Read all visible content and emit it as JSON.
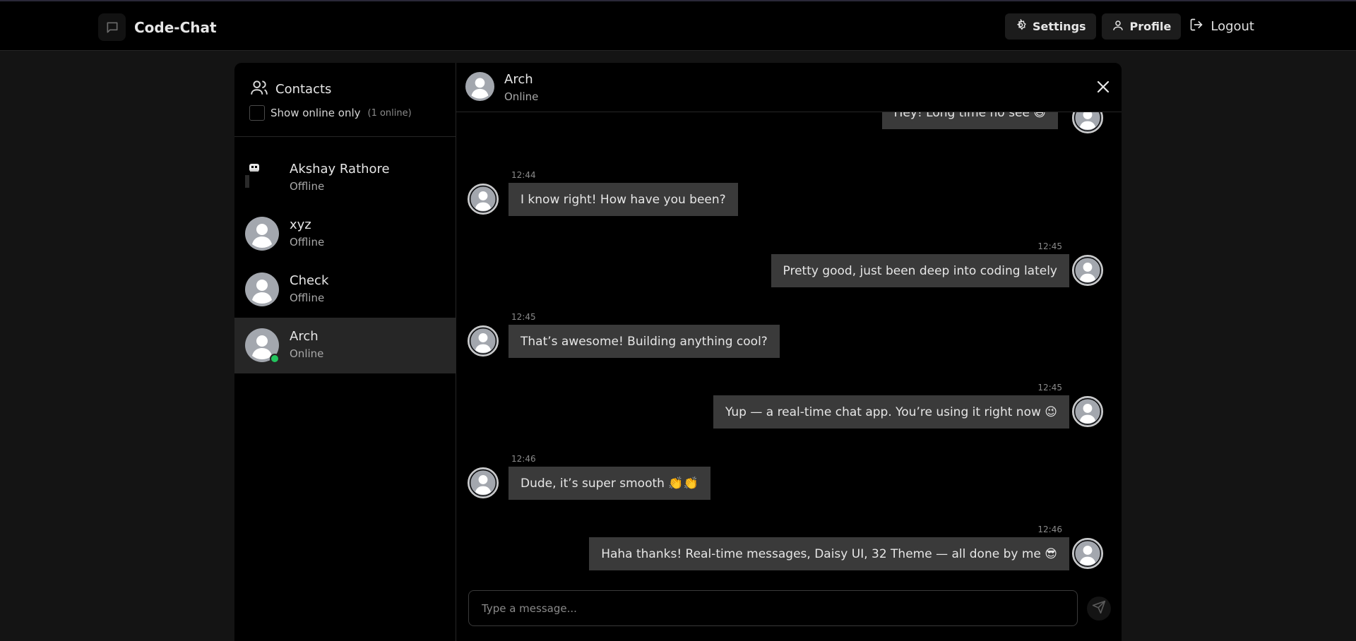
{
  "app": {
    "name": "Code-Chat"
  },
  "nav": {
    "settings": "Settings",
    "profile": "Profile",
    "logout": "Logout"
  },
  "sidebar": {
    "title": "Contacts",
    "filter_label": "Show online only",
    "online_count": "(1 online)",
    "contacts": [
      {
        "name": "Akshay Rathore",
        "status": "Offline"
      },
      {
        "name": "xyz",
        "status": "Offline"
      },
      {
        "name": "Check",
        "status": "Offline"
      },
      {
        "name": "Arch",
        "status": "Online"
      }
    ]
  },
  "chat": {
    "name": "Arch",
    "status": "Online",
    "messages": [
      {
        "from": "me",
        "time": "",
        "text": "Hey! Long time no see 😄"
      },
      {
        "from": "them",
        "time": "12:44",
        "text": "I know right! How have you been?"
      },
      {
        "from": "me",
        "time": "12:45",
        "text": "Pretty good, just been deep into coding lately"
      },
      {
        "from": "them",
        "time": "12:45",
        "text": "That’s awesome! Building anything cool?"
      },
      {
        "from": "me",
        "time": "12:45",
        "text": "Yup — a real-time chat app. You’re using it right now 😉"
      },
      {
        "from": "them",
        "time": "12:46",
        "text": "Dude, it’s super smooth 👏👏"
      },
      {
        "from": "me",
        "time": "12:46",
        "text": "Haha thanks! Real-time messages, Daisy UI, 32 Theme — all done by me 😎"
      }
    ]
  },
  "composer": {
    "placeholder": "Type a message..."
  },
  "colors": {
    "online": "#22c55e",
    "bubble": "#3a3a3a",
    "background": "#000000"
  }
}
